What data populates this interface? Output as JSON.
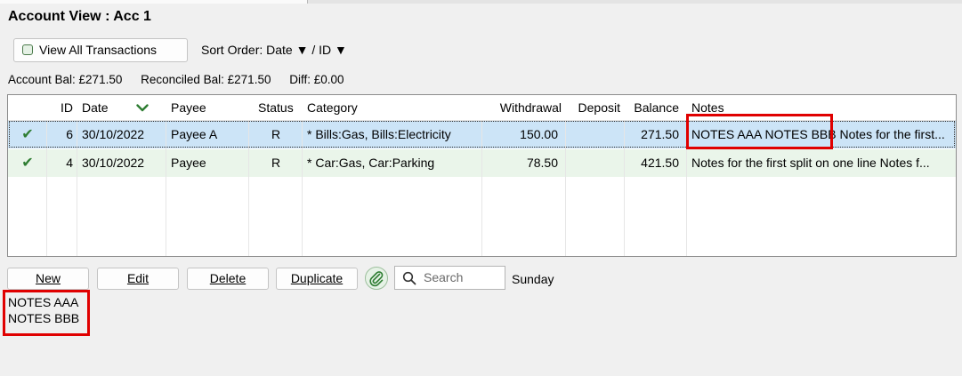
{
  "window": {
    "title": "Account View : Acc 1"
  },
  "toolbar": {
    "view_all_label": "View All Transactions",
    "sort_order": "Sort Order: Date ▼ / ID ▼"
  },
  "balances": {
    "account": "Account Bal: £271.50",
    "reconciled": "Reconciled Bal: £271.50",
    "diff": "Diff: £0.00"
  },
  "table": {
    "columns": [
      "",
      "ID",
      "Date",
      "Payee",
      "Status",
      "Category",
      "Withdrawal",
      "Deposit",
      "Balance",
      "Notes"
    ],
    "rows": [
      {
        "check": "✔",
        "id": "6",
        "date": "30/10/2022",
        "payee": "Payee A",
        "status": "R",
        "category": "* Bills:Gas, Bills:Electricity",
        "withdrawal": "150.00",
        "deposit": "",
        "balance": "271.50",
        "notes": "NOTES AAA NOTES BBB Notes for the first..."
      },
      {
        "check": "✔",
        "id": "4",
        "date": "30/10/2022",
        "payee": "Payee",
        "status": "R",
        "category": "* Car:Gas, Car:Parking",
        "withdrawal": "78.50",
        "deposit": "",
        "balance": "421.50",
        "notes": "Notes for the first split on one line Notes f..."
      }
    ]
  },
  "actions": {
    "new": "New",
    "edit": "Edit",
    "delete": "Delete",
    "duplicate": "Duplicate",
    "search_placeholder": "Search",
    "day": "Sunday"
  },
  "notes_preview": "NOTES AAA\nNOTES BBB",
  "colors": {
    "selected_row": "#cce4f7",
    "reconciled_row": "#eaf5ea",
    "check_green": "#2e7d32",
    "annotation_red": "#e00000"
  }
}
